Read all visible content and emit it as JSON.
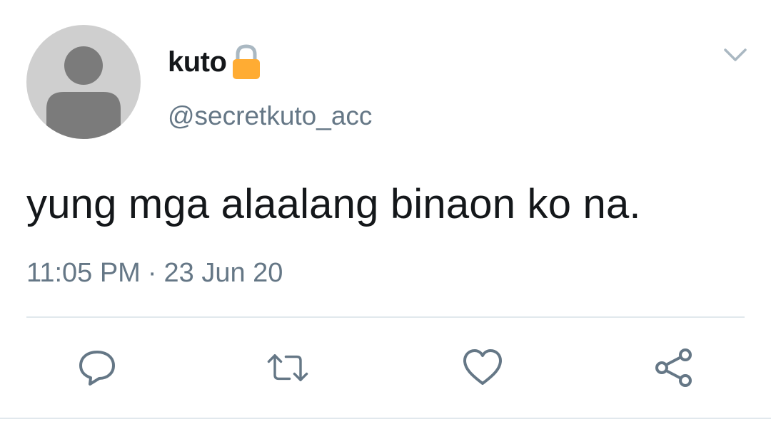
{
  "tweet": {
    "display_name": "kuto",
    "handle": "@secretkuto_acc",
    "text": "yung mga alaalang binaon ko na.",
    "time": "11:05 PM",
    "separator": "·",
    "date": "23 Jun 20",
    "protected_icon": "lock-icon"
  },
  "actions": [
    {
      "icon": "reply-icon"
    },
    {
      "icon": "retweet-icon"
    },
    {
      "icon": "like-icon"
    },
    {
      "icon": "share-icon"
    }
  ],
  "colors": {
    "text_primary": "#14171a",
    "text_secondary": "#657786",
    "icon_gray": "#657786",
    "divider": "#e1e8ed",
    "lock": "#ffac33",
    "avatar_bg": "#cfcfcf",
    "avatar_fg": "#7b7b7b"
  }
}
